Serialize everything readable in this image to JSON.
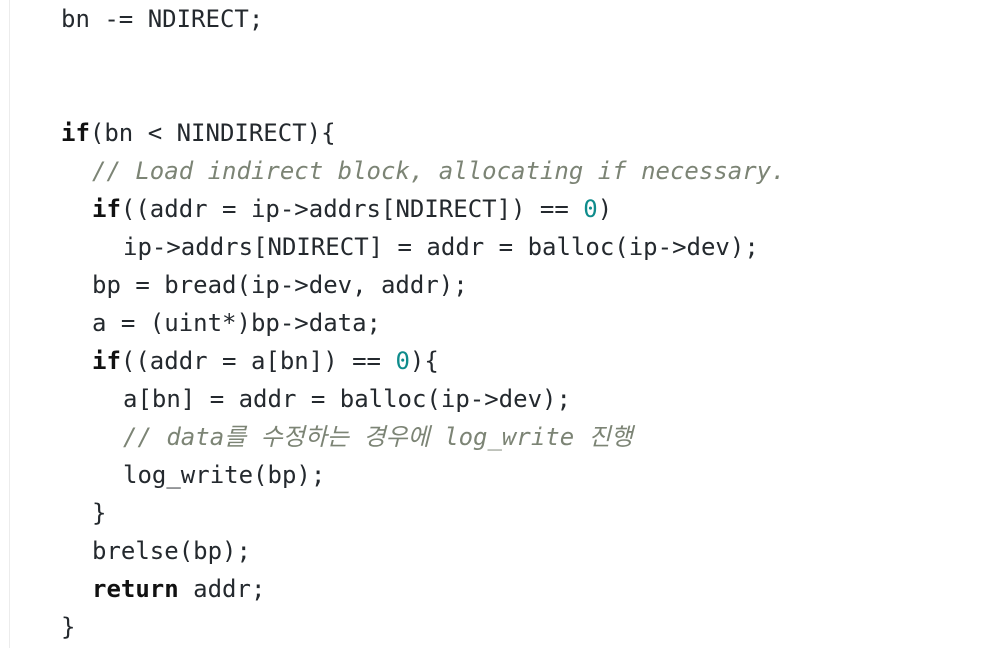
{
  "colors": {
    "background": "#ffffff",
    "text": "#24292e",
    "keyword": "#111111",
    "number": "#0f8c8c",
    "comment": "#7c8475"
  },
  "code": {
    "l0": "bn -= NDIRECT;",
    "l1_kw": "if",
    "l1_rest": "(bn < NINDIRECT){",
    "l2_comment": "// Load indirect block, allocating if necessary.",
    "l3_kw": "if",
    "l3_a": "((addr = ip->addrs[NDIRECT]) == ",
    "l3_num": "0",
    "l3_b": ")",
    "l4": "ip->addrs[NDIRECT] = addr = balloc(ip->dev);",
    "l5": "bp = bread(ip->dev, addr);",
    "l6": "a = (uint*)bp->data;",
    "l7_kw": "if",
    "l7_a": "((addr = a[bn]) == ",
    "l7_num": "0",
    "l7_b": "){",
    "l8": "a[bn] = addr = balloc(ip->dev);",
    "l9_comment": "// data를 수정하는 경우에 log_write 진행",
    "l10": "log_write(bp);",
    "l11": "}",
    "l12": "brelse(bp);",
    "l13_kw": "return",
    "l13_rest": " addr;",
    "l14": "}"
  }
}
